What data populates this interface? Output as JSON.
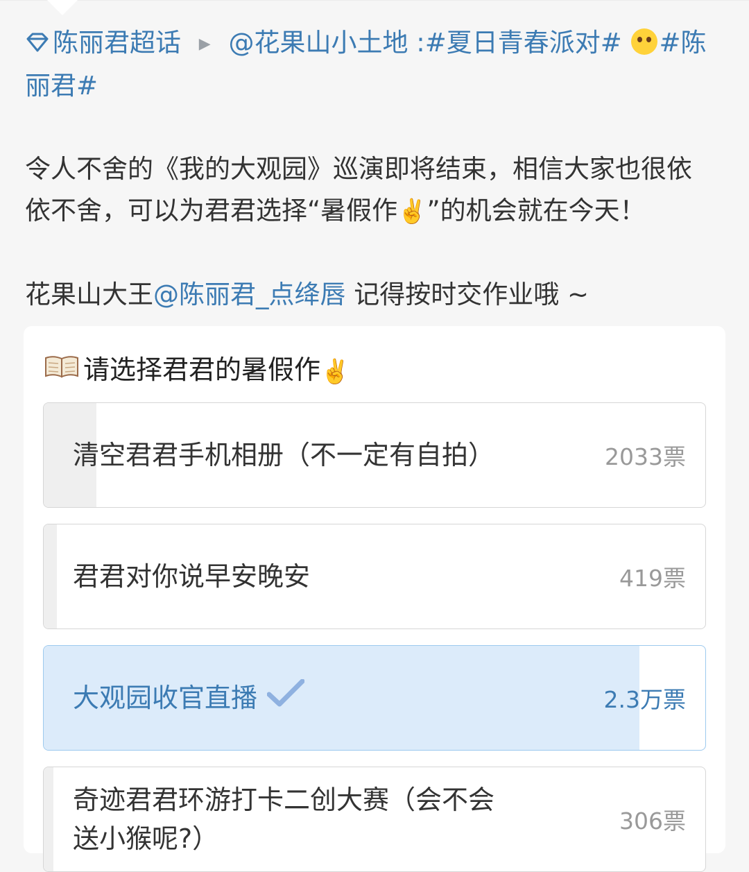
{
  "post": {
    "super_topic": "陈丽君超话",
    "mention_account": "@花果山小土地",
    "colon": " :",
    "hashtag1": "#夏日青春派对#",
    "hashtag2_part1": "#陈",
    "hashtag2_part2": "丽君#",
    "body_line1": "令人不舍的《我的大观园》巡演即将结束，相信大家也很依",
    "body_line2a": "依不舍，可以为君君选择“暑假作",
    "body_line2b": "”的机会就在今天！",
    "body_p2_prefix": "花果山大王",
    "body_p2_mention": "@陈丽君_点绛唇",
    "body_p2_suffix": " 记得按时交作业哦 ~"
  },
  "poll": {
    "title": "请选择君君的暑假作",
    "options": [
      {
        "label": "清空君君手机相册（不一定有自拍）",
        "count": "2033票",
        "fill": 0.08,
        "selected": false
      },
      {
        "label": "君君对你说早安晚安",
        "count": "419票",
        "fill": 0.02,
        "selected": false
      },
      {
        "label": "大观园收官直播",
        "count": "2.3万票",
        "fill": 0.9,
        "selected": true
      },
      {
        "label": "奇迹君君环游打卡二创大赛（会不会送小猴呢?）",
        "count": "306票",
        "fill": 0.015,
        "selected": false
      }
    ]
  },
  "icons": {
    "super_topic": "diamond-icon",
    "arrow": "play-arrow-icon",
    "emoji": "hug-face-emoji-icon",
    "book": "open-book-icon",
    "victory": "victory-hand-icon",
    "check": "checkmark-icon"
  },
  "colors": {
    "link": "#3c7bb3",
    "selected_fill": "#dcebfa",
    "option_fill": "#efefef"
  }
}
